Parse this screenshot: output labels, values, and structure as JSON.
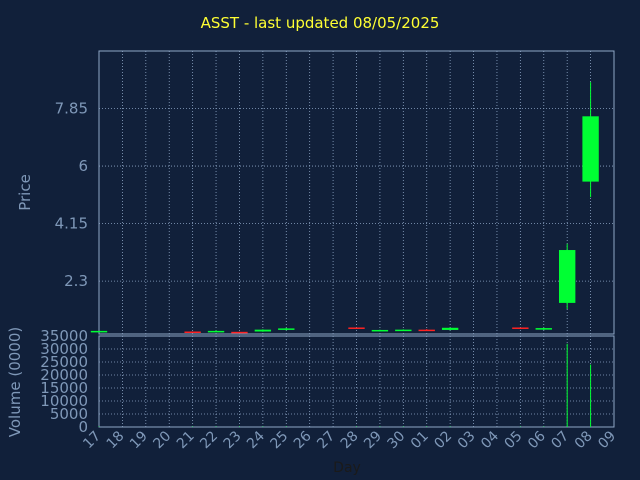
{
  "title": "ASST - last updated 08/05/2025",
  "colors": {
    "background": "#11203a",
    "title": "#ffff33",
    "axis_text": "#7f98b8",
    "grid": "#8fa7c7",
    "up": "#00ff33",
    "down": "#ff2222"
  },
  "chart_data": [
    {
      "type": "candlestick",
      "ylabel": "Price",
      "yticks": [
        "2.3",
        "4.15",
        "6",
        "7.85"
      ],
      "ytick_values": [
        2.3,
        4.15,
        6,
        7.85
      ],
      "ylim": [
        0.6,
        9.7
      ],
      "x_tick_labels": [
        "17",
        "18",
        "19",
        "20",
        "21",
        "22",
        "23",
        "24",
        "25",
        "26",
        "27",
        "28",
        "29",
        "30",
        "01",
        "02",
        "03",
        "04",
        "05",
        "06",
        "07",
        "08",
        "09"
      ],
      "candles": [
        {
          "x": "17",
          "open": 0.7,
          "high": 0.7,
          "low": 0.7,
          "close": 0.7
        },
        {
          "x": "21",
          "open": 0.68,
          "high": 0.68,
          "low": 0.66,
          "close": 0.66
        },
        {
          "x": "22",
          "open": 0.66,
          "high": 0.72,
          "low": 0.66,
          "close": 0.7
        },
        {
          "x": "23",
          "open": 0.67,
          "high": 0.67,
          "low": 0.65,
          "close": 0.65
        },
        {
          "x": "24",
          "open": 0.68,
          "high": 0.75,
          "low": 0.67,
          "close": 0.74
        },
        {
          "x": "25",
          "open": 0.74,
          "high": 0.8,
          "low": 0.72,
          "close": 0.78
        },
        {
          "x": "28",
          "open": 0.81,
          "high": 0.81,
          "low": 0.76,
          "close": 0.77
        },
        {
          "x": "29",
          "open": 0.7,
          "high": 0.74,
          "low": 0.68,
          "close": 0.73
        },
        {
          "x": "30",
          "open": 0.71,
          "high": 0.75,
          "low": 0.7,
          "close": 0.74
        },
        {
          "x": "01",
          "open": 0.74,
          "high": 0.76,
          "low": 0.7,
          "close": 0.71
        },
        {
          "x": "02",
          "open": 0.73,
          "high": 0.81,
          "low": 0.72,
          "close": 0.8
        },
        {
          "x": "05",
          "open": 0.81,
          "high": 0.81,
          "low": 0.76,
          "close": 0.77
        },
        {
          "x": "06",
          "open": 0.74,
          "high": 0.8,
          "low": 0.73,
          "close": 0.79
        },
        {
          "x": "07",
          "open": 1.6,
          "high": 3.5,
          "low": 1.4,
          "close": 3.3
        },
        {
          "x": "08",
          "open": 5.5,
          "high": 8.7,
          "low": 5.0,
          "close": 7.6
        }
      ]
    },
    {
      "type": "bar",
      "xlabel": "Day",
      "ylabel": "Volume (0000)",
      "yticks": [
        "0",
        "5000",
        "10000",
        "15000",
        "20000",
        "25000",
        "30000",
        "35000"
      ],
      "ytick_values": [
        0,
        5000,
        10000,
        15000,
        20000,
        25000,
        30000,
        35000
      ],
      "ylim": [
        0,
        35000
      ],
      "categories": [
        "17",
        "21",
        "22",
        "23",
        "24",
        "25",
        "28",
        "29",
        "30",
        "01",
        "02",
        "05",
        "06",
        "07",
        "08"
      ],
      "values": [
        60,
        40,
        30,
        40,
        70,
        50,
        30,
        20,
        30,
        20,
        30,
        20,
        50,
        32000,
        24000
      ],
      "x_tick_labels": [
        "17",
        "18",
        "19",
        "20",
        "21",
        "22",
        "23",
        "24",
        "25",
        "26",
        "27",
        "28",
        "29",
        "30",
        "01",
        "02",
        "03",
        "04",
        "05",
        "06",
        "07",
        "08",
        "09"
      ]
    }
  ]
}
